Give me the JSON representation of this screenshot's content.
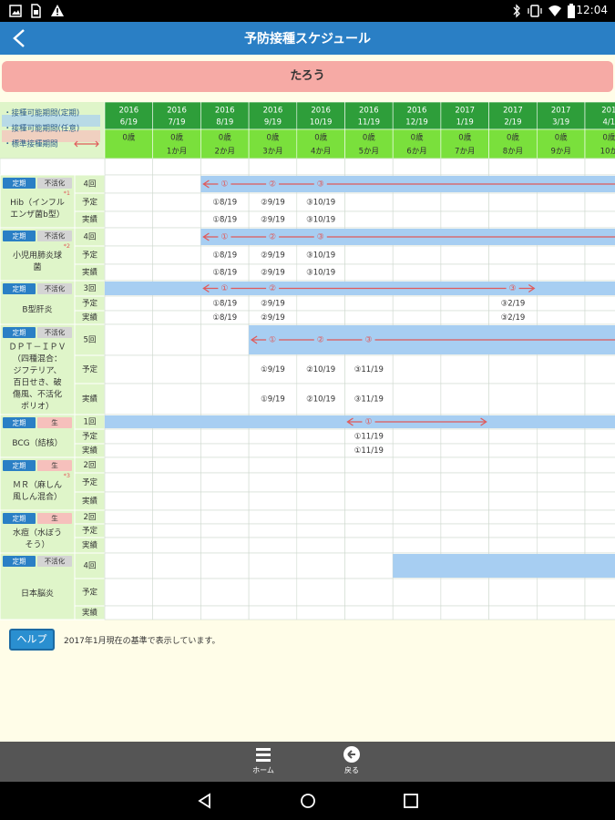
{
  "status_bar": {
    "time": "12:04",
    "left_icons": [
      "image-icon",
      "sim-icon",
      "warning-icon"
    ],
    "right_icons": [
      "bluetooth-icon",
      "vibrate-icon",
      "wifi-icon",
      "battery-icon"
    ]
  },
  "header": {
    "title": "予防接種スケジュール",
    "back_icon": "back-chevron-icon"
  },
  "child_name": "たろう",
  "legend": [
    {
      "label": "・接種可能期間(定期)",
      "color": "#a7cef2"
    },
    {
      "label": "・接種可能期間(任意)",
      "color": "#f6c0bc"
    },
    {
      "label": "・標準接種期間",
      "color": "#e05a5a"
    }
  ],
  "columns": [
    {
      "date": "2016\n6/19",
      "age1": "0歳",
      "age2": ""
    },
    {
      "date": "2016\n7/19",
      "age1": "0歳",
      "age2": "1か月"
    },
    {
      "date": "2016\n8/19",
      "age1": "0歳",
      "age2": "2か月"
    },
    {
      "date": "2016\n9/19",
      "age1": "0歳",
      "age2": "3か月"
    },
    {
      "date": "2016\n10/19",
      "age1": "0歳",
      "age2": "4か月"
    },
    {
      "date": "2016\n11/19",
      "age1": "0歳",
      "age2": "5か月"
    },
    {
      "date": "2016\n12/19",
      "age1": "0歳",
      "age2": "6か月"
    },
    {
      "date": "2017\n1/19",
      "age1": "0歳",
      "age2": "7か月"
    },
    {
      "date": "2017\n2/19",
      "age1": "0歳",
      "age2": "8か月"
    },
    {
      "date": "2017\n3/19",
      "age1": "0歳",
      "age2": "9か月"
    },
    {
      "date": "201\n4/1",
      "age1": "0歳",
      "age2": "10か"
    }
  ],
  "labels": {
    "planned": "予定",
    "actual": "実績",
    "teiki": "定期",
    "fukatsu": "不活化",
    "nama": "生"
  },
  "vaccines": [
    {
      "name": "Hib（インフルエンザ菌b型）",
      "name_lines": [
        "Hib（インフル",
        "エンザ菌b型）"
      ],
      "mark": "*1",
      "kind": "不活化",
      "count": "4回",
      "band": {
        "start": 2,
        "end": 11,
        "type": "teiki"
      },
      "arrow": {
        "start": 2,
        "end": 11,
        "marks": [
          "①",
          "②",
          "③"
        ]
      },
      "planned": [
        {
          "col": 2,
          "text": "①8/19"
        },
        {
          "col": 3,
          "text": "②9/19"
        },
        {
          "col": 4,
          "text": "③10/19"
        }
      ],
      "actual": [
        {
          "col": 2,
          "text": "①8/19"
        },
        {
          "col": 3,
          "text": "②9/19"
        },
        {
          "col": 4,
          "text": "③10/19"
        }
      ]
    },
    {
      "name": "小児用肺炎球菌",
      "name_lines": [
        "小児用肺炎球",
        "菌"
      ],
      "mark": "*2",
      "kind": "不活化",
      "count": "4回",
      "band": {
        "start": 2,
        "end": 11,
        "type": "teiki"
      },
      "arrow": {
        "start": 2,
        "end": 11,
        "marks": [
          "①",
          "②",
          "③"
        ]
      },
      "planned": [
        {
          "col": 2,
          "text": "①8/19"
        },
        {
          "col": 3,
          "text": "②9/19"
        },
        {
          "col": 4,
          "text": "③10/19"
        }
      ],
      "actual": [
        {
          "col": 2,
          "text": "①8/19"
        },
        {
          "col": 3,
          "text": "②9/19"
        },
        {
          "col": 4,
          "text": "③10/19"
        }
      ]
    },
    {
      "name": "B型肝炎",
      "name_lines": [
        "B型肝炎"
      ],
      "mark": "",
      "kind": "不活化",
      "count": "3回",
      "band": {
        "start": 0,
        "end": 11,
        "type": "teiki"
      },
      "arrow": {
        "start": 2,
        "end": 9,
        "marks": [
          "①",
          "②",
          "③"
        ]
      },
      "planned": [
        {
          "col": 2,
          "text": "①8/19"
        },
        {
          "col": 3,
          "text": "②9/19"
        },
        {
          "col": 8,
          "text": "③2/19"
        }
      ],
      "actual": [
        {
          "col": 2,
          "text": "①8/19"
        },
        {
          "col": 3,
          "text": "②9/19"
        },
        {
          "col": 8,
          "text": "③2/19"
        }
      ]
    },
    {
      "name": "DPT-IPV（四種混合：ジフテリア、百日せき、破傷風、不活化ポリオ）",
      "name_lines": [
        "ＤＰＴ－ＩＰＶ",
        "（四種混合：",
        "ジフテリア、",
        "百日せき、破",
        "傷風、不活化",
        "ポリオ）"
      ],
      "mark": "",
      "kind": "不活化",
      "count": "5回",
      "band": {
        "start": 3,
        "end": 11,
        "type": "teiki"
      },
      "arrow": {
        "start": 3,
        "end": 11,
        "marks": [
          "①",
          "②",
          "③"
        ]
      },
      "planned": [
        {
          "col": 3,
          "text": "①9/19"
        },
        {
          "col": 4,
          "text": "②10/19"
        },
        {
          "col": 5,
          "text": "③11/19"
        }
      ],
      "actual": [
        {
          "col": 3,
          "text": "①9/19"
        },
        {
          "col": 4,
          "text": "②10/19"
        },
        {
          "col": 5,
          "text": "③11/19"
        }
      ]
    },
    {
      "name": "BCG（結核）",
      "name_lines": [
        "BCG（結核）"
      ],
      "mark": "",
      "kind": "生",
      "count": "1回",
      "band": {
        "start": 0,
        "end": 11,
        "type": "teiki"
      },
      "arrow": {
        "start": 5,
        "end": 8,
        "marks": [
          "①"
        ]
      },
      "planned": [
        {
          "col": 5,
          "text": "①11/19"
        }
      ],
      "actual": [
        {
          "col": 5,
          "text": "①11/19"
        }
      ]
    },
    {
      "name": "MR（麻しん風しん混合）",
      "name_lines": [
        "ＭＲ（麻しん",
        "風しん混合）"
      ],
      "mark": "*3",
      "kind": "生",
      "count": "2回",
      "band": null,
      "arrow": null,
      "planned": [],
      "actual": []
    },
    {
      "name": "水痘（水ぼうそう）",
      "name_lines": [
        "水痘（水ぼう",
        "そう）"
      ],
      "mark": "",
      "kind": "生",
      "count": "2回",
      "band": null,
      "arrow": null,
      "planned": [],
      "actual": []
    },
    {
      "name": "日本脳炎",
      "name_lines": [
        "日本脳炎"
      ],
      "mark": "",
      "kind": "不活化",
      "count": "4回",
      "band": {
        "start": 6,
        "end": 11,
        "type": "teiki"
      },
      "arrow": null,
      "planned": [],
      "actual": []
    }
  ],
  "help": {
    "label": "ヘルプ",
    "note": "2017年1月現在の基準で表示しています。"
  },
  "toolbar": [
    {
      "label": "ホーム",
      "icon": "home-menu-icon"
    },
    {
      "label": "戻る",
      "icon": "return-icon"
    }
  ],
  "nav_icons": [
    "back-triangle-icon",
    "home-circle-icon",
    "recents-square-icon"
  ],
  "colors": {
    "header_bg": "#2a7fc5",
    "date_header_bg": "#2e9e3a",
    "age_header_bg": "#7ae03c",
    "label_bg": "#dff5c9",
    "teiki_band": "#a7cef2",
    "arrow": "#e05a5a",
    "teiki_badge": "#2a7fc5",
    "fukatsu_badge": "#d4d4d4",
    "nama_badge": "#f6c0bc"
  }
}
